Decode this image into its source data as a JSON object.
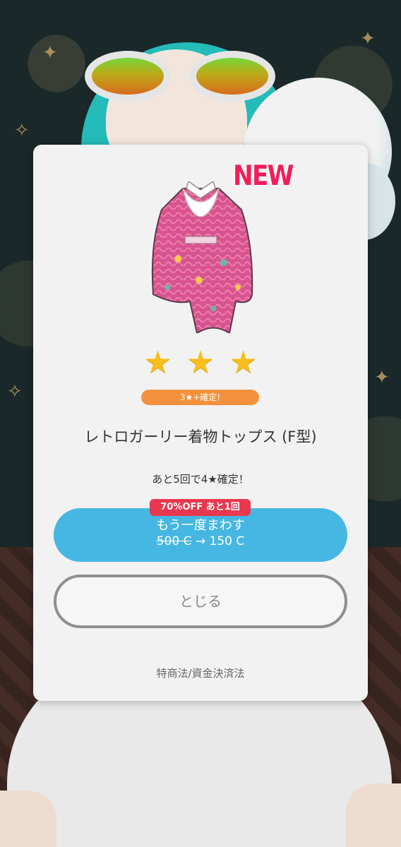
{
  "result": {
    "new_label": "NEW",
    "item_icon": "kimono-top-icon",
    "stars": [
      "★",
      "★",
      "★"
    ],
    "star_color": "#f7be1c",
    "guarantee_badge": "3★+確定!",
    "item_name": "レトロガーリー着物トップス (F型)",
    "pity_text": "あと5回で4★確定！"
  },
  "spin_again": {
    "discount_badge": "70%OFF あと1回",
    "label": "もう一度まわす",
    "old_price": "500 C",
    "arrow": "→",
    "new_price": "150 C",
    "color": "#46b7e2"
  },
  "close": {
    "label": "とじる"
  },
  "legal": {
    "link": "特商法/資金決済法"
  }
}
